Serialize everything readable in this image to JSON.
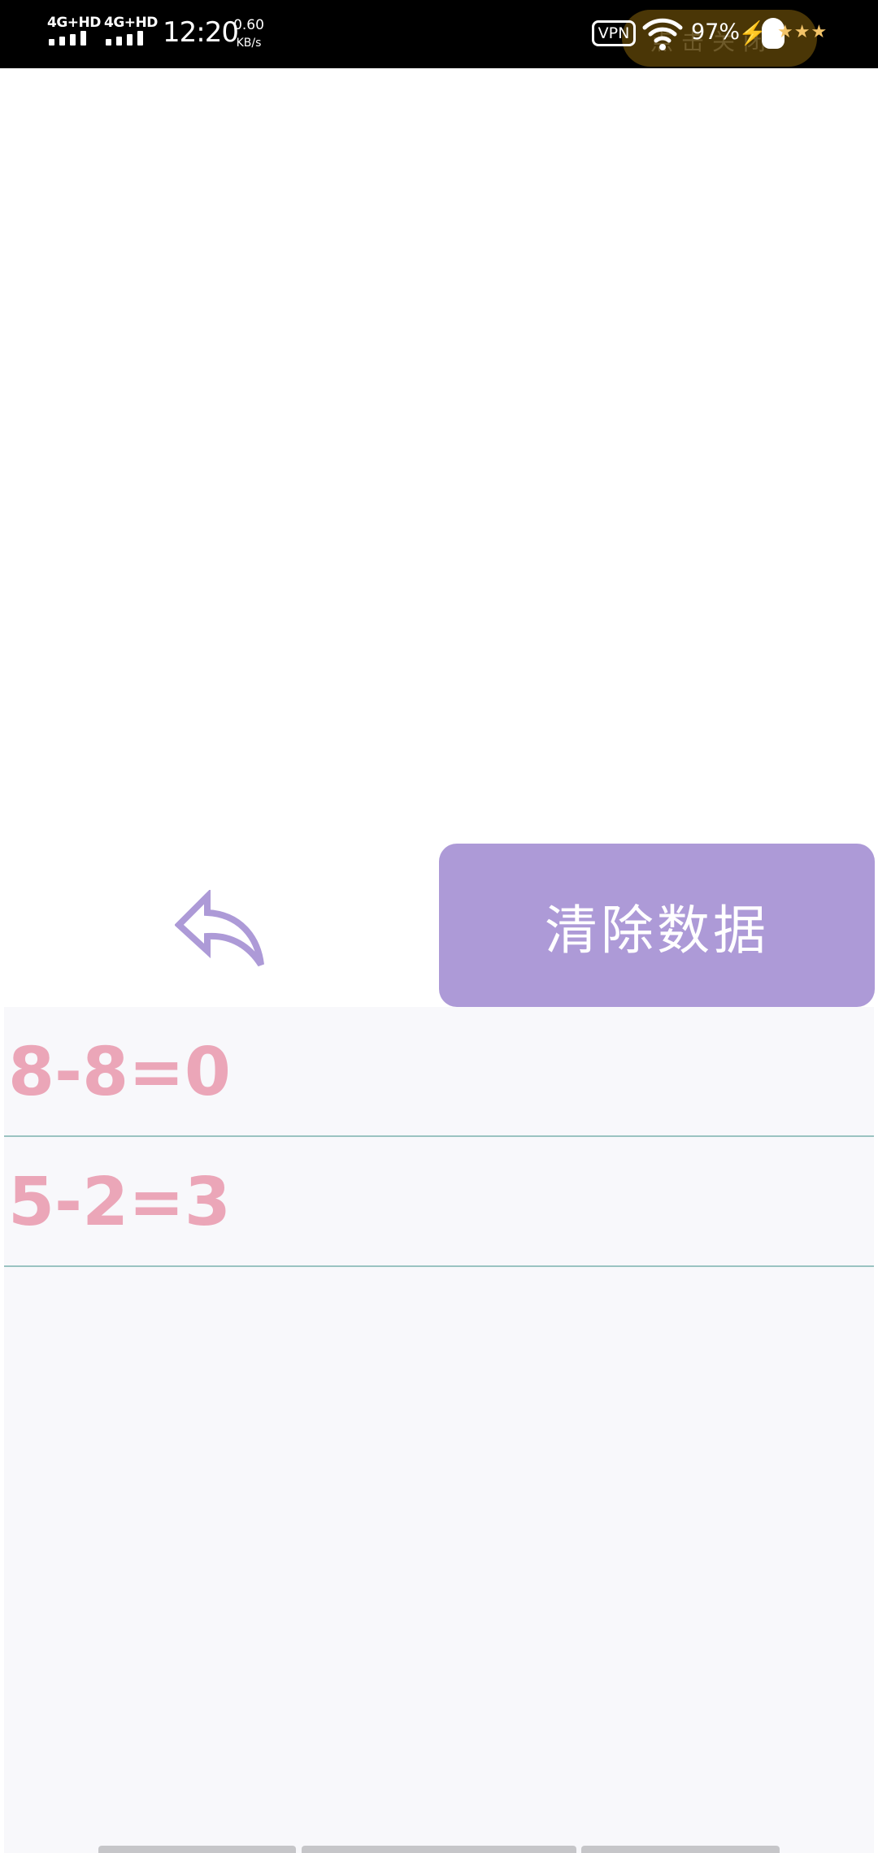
{
  "status_bar": {
    "network1": "4G+HD",
    "network2": "4G+HD",
    "time": "12:20",
    "speed_value": "0.60",
    "speed_unit": "KB/s",
    "vpn": "VPN",
    "pill_text": "点击关闭",
    "battery": "97%",
    "stars": "★★★",
    "colors": {
      "pill": "#4a3606",
      "stars": "#f3c469"
    }
  },
  "controls": {
    "back_icon": "back-arrow-icon",
    "clear_label": "清除数据",
    "colors": {
      "clear_button": "#ad9ad7",
      "back_icon": "#ad9ad7"
    }
  },
  "history": {
    "items": [
      "8-8=0",
      "5-2=3"
    ],
    "colors": {
      "text": "#eba6b8",
      "divider": "#9ac3c1",
      "background": "#f8f8fb"
    }
  }
}
